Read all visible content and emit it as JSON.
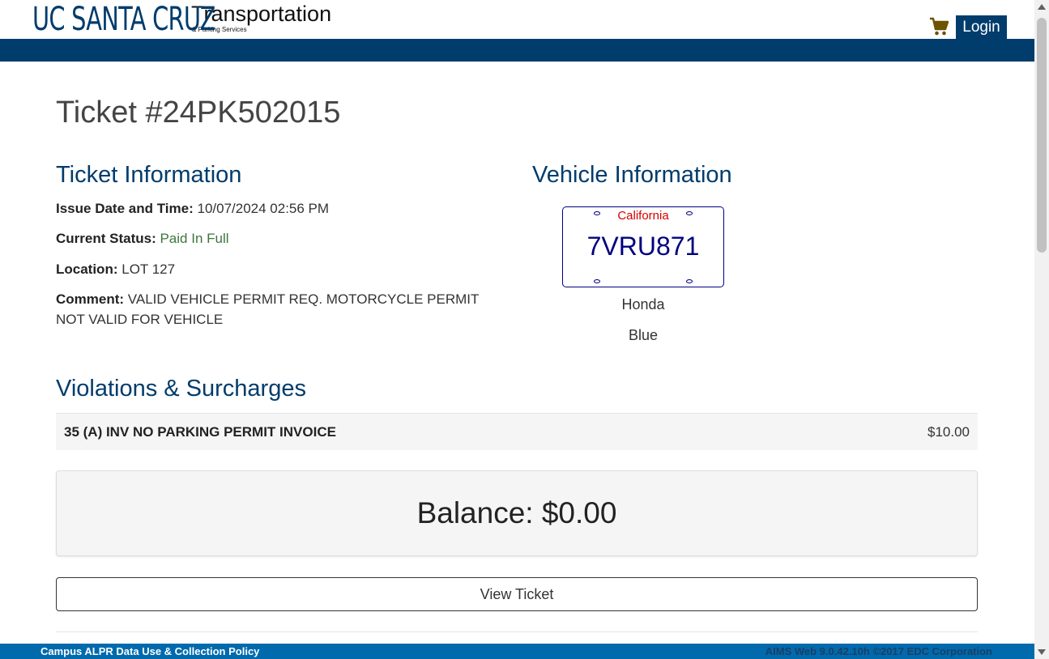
{
  "header": {
    "logo_main": "UC SANTA CRUZ",
    "logo_title": "Transportation",
    "logo_subtitle": "& Parking Services",
    "cart_icon": "shopping-cart-icon",
    "login_label": "Login"
  },
  "ticket": {
    "title": "Ticket #24PK502015"
  },
  "ticket_info": {
    "heading": "Ticket Information",
    "issue_label": "Issue Date and Time:",
    "issue_value": "10/07/2024 02:56 PM",
    "status_label": "Current Status:",
    "status_value": "Paid In Full",
    "location_label": "Location:",
    "location_value": "LOT 127",
    "comment_label": "Comment:",
    "comment_value": "VALID VEHICLE PERMIT REQ. MOTORCYCLE PERMIT NOT VALID FOR VEHICLE"
  },
  "vehicle_info": {
    "heading": "Vehicle Information",
    "plate_state": "California",
    "plate_number": "7VRU871",
    "make": "Honda",
    "color": "Blue"
  },
  "violations": {
    "heading": "Violations & Surcharges",
    "items": [
      {
        "description": "35 (A) INV NO PARKING PERMIT INVOICE",
        "amount": "$10.00"
      }
    ]
  },
  "balance": {
    "text": "Balance: $0.00"
  },
  "actions": {
    "view_ticket_label": "View Ticket"
  },
  "footer": {
    "policy_link": "Campus ALPR Data Use & Collection Policy",
    "copyright": "AIMS Web 9.0.42.10h ©2017 EDC Corporation"
  },
  "colors": {
    "brand_navy": "#003c6c",
    "footer_blue": "#006aad",
    "status_green": "#3c763d",
    "plate_red": "#d40000",
    "plate_blue": "#000080"
  }
}
